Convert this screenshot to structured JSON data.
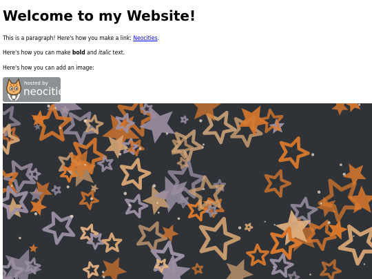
{
  "heading": "Welcome to my Website!",
  "p1": {
    "text": "This is a paragraph! Here's how you make a link: ",
    "link": "Neocities",
    "end": "."
  },
  "p2": {
    "before": "Here's how you can make ",
    "bold": "bold",
    "middle": " and ",
    "italic": "italic",
    "after": " text."
  },
  "p3": "Here's how you can add an image:",
  "badge": {
    "small": "hosted by",
    "big": "neocities",
    "icon": "neocities-cat-icon"
  },
  "banner": {
    "icon": "stars-pattern-image",
    "colors": {
      "bg": "#2f3338",
      "orange": "#d9782d",
      "tan": "#d4a373",
      "lavender": "#9b8fa3",
      "sand": "#e0b080"
    }
  }
}
